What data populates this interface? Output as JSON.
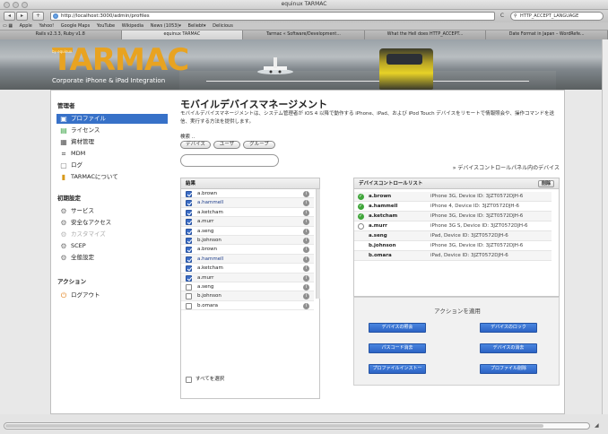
{
  "window": {
    "title": "equinux TARMAC"
  },
  "toolbar": {
    "back": "◂",
    "forward": "▸",
    "add_bookmark": "+",
    "url": "http://localhost:3000/admin/profiles",
    "reload": "C",
    "search_value": "HTTP_ACCEPT_LANGUAGE"
  },
  "bookmarks": [
    "Apple",
    "Yahoo!",
    "Google Maps",
    "YouTube",
    "Wikipedia",
    "News (1053)▾",
    "Beliebt▾",
    "Delicious"
  ],
  "tabs": [
    {
      "label": "Rails v2.3.3, Ruby v1.8",
      "active": false
    },
    {
      "label": "equinux TARMAC",
      "active": true
    },
    {
      "label": "Tarmac « Software/Development...",
      "active": false
    },
    {
      "label": "What the Hell does HTTP_ACCEPT...",
      "active": false
    },
    {
      "label": "Date Format in Japan – WordRefe...",
      "active": false
    }
  ],
  "banner": {
    "logo_sub": "by equinux",
    "logo": "TARMAC",
    "tagline": "Corporate iPhone & iPad Integration"
  },
  "sidebar": {
    "admin_title": "管理者",
    "admin_items": [
      {
        "label": "プロファイル",
        "icon": "profile-icon",
        "selected": true
      },
      {
        "label": "ライセンス",
        "icon": "license-icon",
        "selected": false
      },
      {
        "label": "資材管理",
        "icon": "asset-icon",
        "selected": false
      },
      {
        "label": "MDM",
        "icon": "mdm-icon",
        "selected": false
      },
      {
        "label": "ログ",
        "icon": "log-icon",
        "selected": false
      },
      {
        "label": "TARMACについて",
        "icon": "about-icon",
        "selected": false
      }
    ],
    "init_title": "初期設定",
    "init_items": [
      {
        "label": "サービス",
        "icon": "gear-icon",
        "dim": false
      },
      {
        "label": "安全なアクセス",
        "icon": "gear-icon",
        "dim": false
      },
      {
        "label": "カスタマイズ",
        "icon": "gear-icon",
        "dim": true
      },
      {
        "label": "SCEP",
        "icon": "gear-icon",
        "dim": false
      },
      {
        "label": "全般設定",
        "icon": "gear-icon",
        "dim": false
      }
    ],
    "action_title": "アクション",
    "logout": "ログアウト"
  },
  "main": {
    "title": "モバイルデバイスマネージメント",
    "description": "モバイルデバイスマネージメントは、システム管理者が iOS 4 以降で動作する iPhone、iPad、および iPod Touch デバイスをリモートで情報照会や、操作コマンドを送信、実行する方法を提供します。",
    "tab_label": "検索 ..",
    "seg_buttons": [
      "デバイス",
      "ユーザ",
      "グループ"
    ],
    "search_value": "",
    "control_hint": "» デバイスコントロールパネル内のデバイス",
    "results_header": "結果",
    "results": [
      {
        "name": "a.brown",
        "checked": true
      },
      {
        "name": "a.hammell",
        "checked": true
      },
      {
        "name": "a.ketcham",
        "checked": true
      },
      {
        "name": "a.murr",
        "checked": true
      },
      {
        "name": "a.seng",
        "checked": true
      },
      {
        "name": "b.johnson",
        "checked": true
      },
      {
        "name": "a.brown",
        "checked": true
      },
      {
        "name": "a.hammell",
        "checked": true
      },
      {
        "name": "a.ketcham",
        "checked": true
      },
      {
        "name": "a.murr",
        "checked": true
      },
      {
        "name": "a.seng",
        "checked": false
      },
      {
        "name": "b.johnson",
        "checked": false
      },
      {
        "name": "b.omara",
        "checked": false
      }
    ],
    "select_all": "すべてを選択",
    "device_header": "デバイスコントロールリスト",
    "delete_label": "削除",
    "devices": [
      {
        "name": "a.brown",
        "device": "iPhone 3G, Device ID: 3JZT0572DJH-6",
        "status": "ok"
      },
      {
        "name": "a.hammell",
        "device": "iPhone 4, Device ID: 3JZT0572DJH-6",
        "status": "ok"
      },
      {
        "name": "a.ketcham",
        "device": "iPhone 3G, Device ID: 3JZT0572DJH-6",
        "status": "ok"
      },
      {
        "name": "a.murr",
        "device": "iPhone 3G S, Device ID: 3JZT0572DJH-6",
        "status": "wait"
      },
      {
        "name": "a.seng",
        "device": "iPad, Device ID: 3JZT0572DJH-6",
        "status": "none"
      },
      {
        "name": "b.johnson",
        "device": "iPhone 3G, Device ID: 3JZT0572DJH-6",
        "status": "none"
      },
      {
        "name": "b.omara",
        "device": "iPad, Device ID: 3JZT0572DJH-6",
        "status": "none"
      }
    ],
    "actions_title": "アクションを適用",
    "actions": [
      "デバイスの照会",
      "デバイスのロック",
      "パスコード消去",
      "デバイスの消去",
      "プロファイルインストー",
      "プロファイル削除"
    ]
  },
  "colors": {
    "accent": "#3771c8",
    "logo": "#e8a321",
    "action_button": "#2c63c4"
  }
}
